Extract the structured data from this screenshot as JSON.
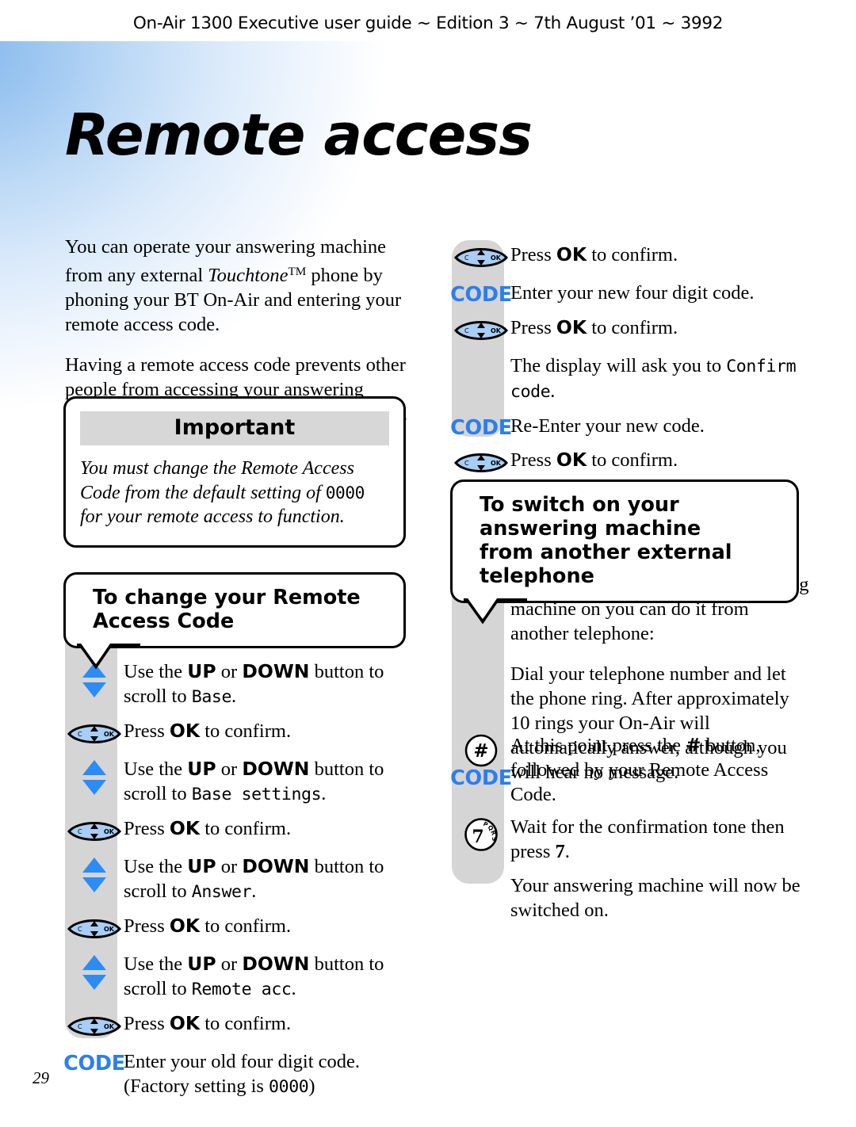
{
  "header": {
    "running_head": "On-Air 1300 Executive user guide ~ Edition 3 ~ 7th August ’01 ~ 3992"
  },
  "title": "Remote access",
  "page_number": "29",
  "colors": {
    "accent_blue": "#2b7ef0",
    "key_fill_blue": "#a8cef5",
    "strip_grey": "#d5d5d5",
    "bar_grey": "#d7d7d7",
    "background_gradient_from": "#86b9ee",
    "background_gradient_to": "#ffffff"
  },
  "intro": {
    "paragraph_1_part_1": "You can operate your answering machine from any external ",
    "paragraph_1_italic": "Touchtone",
    "paragraph_1_tm": "TM",
    "paragraph_1_part_2": " phone by phoning your BT On-Air and entering your remote access code.",
    "paragraph_2": "Having a remote access code prevents other people from accessing your answering machine functions without your permission."
  },
  "important_box": {
    "heading": "Important",
    "body_part_1": "You must change the Remote Access Code from the default setting of ",
    "body_code": "0000",
    "body_part_2": " for your remote access to function."
  },
  "callout_left": {
    "line_1": "To change your Remote",
    "line_2": "Access Code"
  },
  "callout_right": {
    "line_1": "To switch on your answering machine",
    "line_2": "from another external telephone"
  },
  "steps_left": [
    {
      "icon": "up-down-arrows-icon",
      "text_part_1": "Use the ",
      "bold_1": "UP",
      "text_part_2": " or ",
      "bold_2": "DOWN",
      "text_part_3": " button to scroll to ",
      "lcd": "Base",
      "text_part_4": "."
    },
    {
      "icon": "ok-navigation-key-icon",
      "text_part_1": "Press ",
      "bold_1": "OK",
      "text_part_2": " to confirm."
    },
    {
      "icon": "up-down-arrows-icon",
      "text_part_1": "Use the ",
      "bold_1": "UP",
      "text_part_2": " or ",
      "bold_2": "DOWN",
      "text_part_3": " button to scroll to ",
      "lcd": "Base settings",
      "text_part_4": "."
    },
    {
      "icon": "ok-navigation-key-icon",
      "text_part_1": "Press ",
      "bold_1": "OK",
      "text_part_2": " to confirm."
    },
    {
      "icon": "up-down-arrows-icon",
      "text_part_1": "Use the ",
      "bold_1": "UP",
      "text_part_2": " or ",
      "bold_2": "DOWN",
      "text_part_3": " button to scroll to ",
      "lcd": "Answer",
      "text_part_4": "."
    },
    {
      "icon": "ok-navigation-key-icon",
      "text_part_1": "Press ",
      "bold_1": "OK",
      "text_part_2": " to confirm."
    },
    {
      "icon": "up-down-arrows-icon",
      "text_part_1": "Use the ",
      "bold_1": "UP",
      "text_part_2": " or ",
      "bold_2": "DOWN",
      "text_part_3": " button to scroll to ",
      "lcd": "Remote acc",
      "text_part_4": "."
    },
    {
      "icon": "ok-navigation-key-icon",
      "text_part_1": "Press ",
      "bold_1": "OK",
      "text_part_2": " to confirm."
    },
    {
      "icon": "code-label-icon",
      "icon_label": "CODE",
      "text_part_1": "Enter your old four digit code. (Factory setting is ",
      "lcd": "0000",
      "text_part_2": ")"
    }
  ],
  "steps_right_top": [
    {
      "icon": "ok-navigation-key-icon",
      "text_part_1": "Press ",
      "bold_1": "OK",
      "text_part_2": " to confirm."
    },
    {
      "icon": "code-label-icon",
      "icon_label": "CODE",
      "text_part_1": "Enter your new four digit code."
    },
    {
      "icon": "ok-navigation-key-icon",
      "text_part_1": "Press ",
      "bold_1": "OK",
      "text_part_2": " to confirm."
    },
    {
      "icon": "none",
      "text_part_1": "The display will ask you to ",
      "lcd": "Confirm code",
      "text_part_2": "."
    },
    {
      "icon": "code-label-icon",
      "icon_label": "CODE",
      "text_part_1": "Re-Enter your new code."
    },
    {
      "icon": "ok-navigation-key-icon",
      "text_part_1": "Press ",
      "bold_1": "OK",
      "text_part_2": " to confirm."
    }
  ],
  "right_body": {
    "paragraph_1": "If you forget to switch your answering machine on you can do it from another telephone:",
    "paragraph_2": "Dial your telephone number and let the phone ring. After approximately 10 rings your On-Air will automatically answer, although you will hear no message."
  },
  "steps_right_bottom": [
    {
      "icon": "hash-key-icon",
      "icon_label": "#",
      "sub_icon": "code-label-icon",
      "sub_icon_label": "CODE",
      "text_part_1": "At this point press the ",
      "hash": "#",
      "text_part_2": " button, followed by your Remote Access Code."
    },
    {
      "icon": "seven-key-icon",
      "icon_label": "7",
      "icon_sublabel": "PQRS",
      "text_part_1": "Wait for the confirmation tone then press ",
      "bold_1": "7",
      "text_part_2": "."
    },
    {
      "icon": "none",
      "text_part_1": "Your answering machine will now be switched on."
    }
  ]
}
